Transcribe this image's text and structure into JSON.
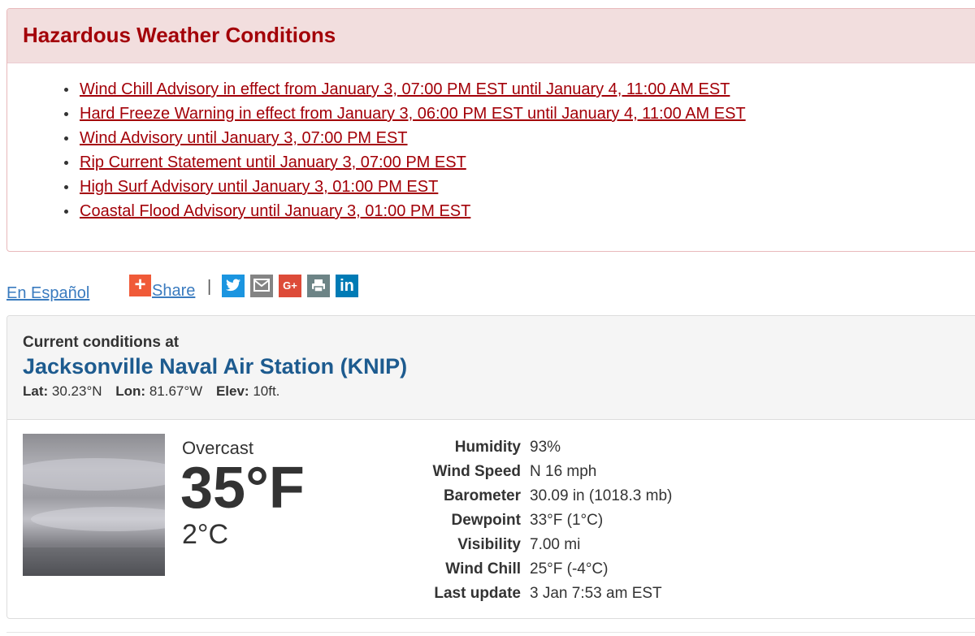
{
  "hazards": {
    "title": "Hazardous Weather Conditions",
    "items": [
      "Wind Chill Advisory in effect from January 3, 07:00 PM EST until January 4, 11:00 AM EST",
      "Hard Freeze Warning in effect from January 3, 06:00 PM EST until January 4, 11:00 AM EST",
      "Wind Advisory until January 3, 07:00 PM EST",
      "Rip Current Statement until January 3, 07:00 PM EST",
      "High Surf Advisory until January 3, 01:00 PM EST",
      "Coastal Flood Advisory until January 3, 01:00 PM EST"
    ],
    "color": "#a30008",
    "header_bg": "#f2dede"
  },
  "links": {
    "espanol": "En Español",
    "share_plus": "+",
    "share": "Share",
    "separator": "|",
    "buttons": [
      {
        "name": "twitter",
        "icon": "twitter-icon",
        "color": "#1b95e0"
      },
      {
        "name": "email",
        "icon": "envelope-icon",
        "color": "#848484"
      },
      {
        "name": "google-plus",
        "icon": "google-plus-icon",
        "color": "#dd4b39",
        "text": "G+"
      },
      {
        "name": "print",
        "icon": "printer-icon",
        "color": "#6d8486"
      },
      {
        "name": "linkedin",
        "icon": "linkedin-icon",
        "color": "#007bb5",
        "text": "in"
      }
    ]
  },
  "current": {
    "label": "Current conditions at",
    "station": "Jacksonville Naval Air Station (KNIP)",
    "lat_label": "Lat:",
    "lat": "30.23°N",
    "lon_label": "Lon:",
    "lon": "81.67°W",
    "elev_label": "Elev:",
    "elev": "10ft.",
    "image": "overcast-sky-image",
    "summary": "Overcast",
    "temp_f": "35°F",
    "temp_c": "2°C",
    "details": [
      {
        "label": "Humidity",
        "value": "93%"
      },
      {
        "label": "Wind Speed",
        "value": "N 16 mph"
      },
      {
        "label": "Barometer",
        "value": "30.09 in (1018.3 mb)"
      },
      {
        "label": "Dewpoint",
        "value": "33°F (1°C)"
      },
      {
        "label": "Visibility",
        "value": "7.00 mi"
      },
      {
        "label": "Wind Chill",
        "value": "25°F (-4°C)"
      },
      {
        "label": "Last update",
        "value": "3 Jan 7:53 am EST"
      }
    ]
  }
}
